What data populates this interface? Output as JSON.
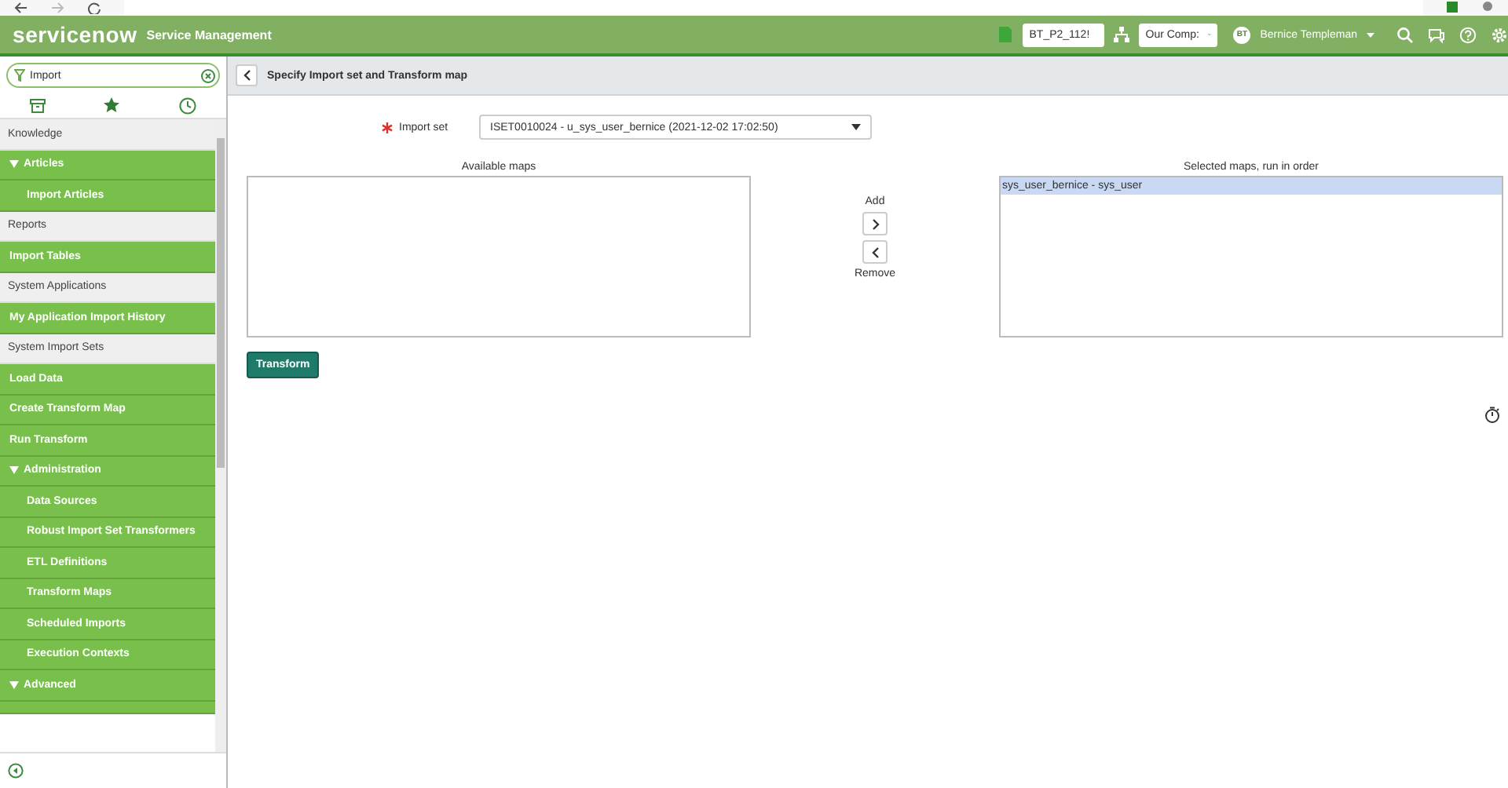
{
  "header": {
    "logo": "servicenow",
    "product": "Service Management",
    "update_set": "BT_P2_112!",
    "company": "Our Comp:",
    "user": {
      "initials": "BT",
      "name": "Bernice Templeman"
    }
  },
  "sidebar": {
    "filter": {
      "value": "Import"
    },
    "items": [
      {
        "label": "Knowledge",
        "kind": "section",
        "children": [
          {
            "label": "Articles",
            "kind": "module",
            "expanded": true,
            "children": [
              {
                "label": "Import Articles",
                "kind": "module"
              }
            ]
          }
        ]
      },
      {
        "label": "Reports",
        "kind": "section",
        "children": [
          {
            "label": "Import Tables",
            "kind": "module"
          }
        ]
      },
      {
        "label": "System Applications",
        "kind": "section",
        "children": [
          {
            "label": "My Application Import History",
            "kind": "module"
          }
        ]
      },
      {
        "label": "System Import Sets",
        "kind": "section",
        "children": [
          {
            "label": "Load Data",
            "kind": "module"
          },
          {
            "label": "Create Transform Map",
            "kind": "module"
          },
          {
            "label": "Run Transform",
            "kind": "module"
          },
          {
            "label": "Administration",
            "kind": "module",
            "expanded": true,
            "children": [
              {
                "label": "Data Sources",
                "kind": "module"
              },
              {
                "label": "Robust Import Set Transformers",
                "kind": "module"
              },
              {
                "label": "ETL Definitions",
                "kind": "module"
              },
              {
                "label": "Transform Maps",
                "kind": "module"
              },
              {
                "label": "Scheduled Imports",
                "kind": "module"
              },
              {
                "label": "Execution Contexts",
                "kind": "module"
              }
            ]
          },
          {
            "label": "Advanced",
            "kind": "module",
            "expanded": true
          }
        ]
      }
    ]
  },
  "page": {
    "title": "Specify Import set and Transform map",
    "import_set": {
      "label": "Import set",
      "required": true,
      "value": "ISET0010024 - u_sys_user_bernice (2021-12-02 17:02:50)"
    },
    "available_maps": {
      "label": "Available maps"
    },
    "add_label": "Add",
    "remove_label": "Remove",
    "selected_maps": {
      "label": "Selected maps, run in order",
      "options": [
        {
          "text": "sys_user_bernice - sys_user",
          "selected": true
        }
      ]
    },
    "transform_button": "Transform"
  }
}
